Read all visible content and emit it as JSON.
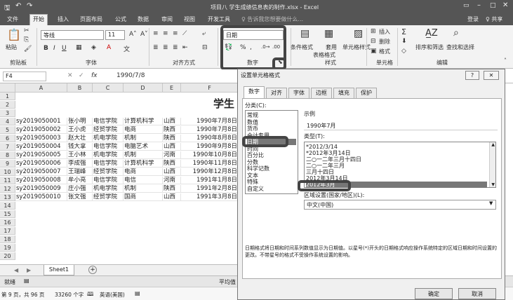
{
  "titlebar": {
    "title": "项目八 学生成绩信息表的制作.xlsx - Excel"
  },
  "ribbon_tabs": [
    "文件",
    "开始",
    "插入",
    "页面布局",
    "公式",
    "数据",
    "审阅",
    "视图",
    "开发工具"
  ],
  "tell_me": "♀ 告诉我您想要做什么...",
  "account": {
    "login": "登录",
    "share": "♀ 共享"
  },
  "ribbon": {
    "paste": "粘贴",
    "font_name": "等线",
    "font_size": "11",
    "number_format": "日期",
    "bold": "B",
    "italic": "I",
    "underline": "U",
    "percent": "%",
    "comma": ",",
    "cond_format": "条件格式",
    "table_format_1": "套用",
    "table_format_2": "表格格式",
    "cell_style": "单元格样式",
    "insert": "插入",
    "delete": "删除",
    "format": "格式",
    "sort_filter": "排序和筛选",
    "find_select": "查找和选择",
    "groups": {
      "clipboard": "剪贴板",
      "font": "字体",
      "align": "对齐方式",
      "number": "数字",
      "styles": "样式",
      "cells": "单元格",
      "edit": "编辑"
    }
  },
  "formula_bar": {
    "name_box": "F4",
    "fx": "fx",
    "value": "1990/7/8"
  },
  "sheet": {
    "columns": [
      "A",
      "B",
      "C",
      "D",
      "E",
      "F"
    ],
    "rows": [
      "1",
      "2",
      "3",
      "4",
      "5",
      "6",
      "7",
      "8",
      "9",
      "10",
      "11",
      "12",
      "13",
      "14",
      "15",
      "16",
      "17",
      "18",
      "19",
      "20"
    ],
    "title_partial": "学生",
    "data": [
      [
        "sy2019050001",
        "张小明",
        "电信学院",
        "计算机科学",
        "山西",
        "1990年7月8日"
      ],
      [
        "sy2019050002",
        "王小虎",
        "经贸学院",
        "电商",
        "陕西",
        "1990年7月8日"
      ],
      [
        "sy2019050003",
        "赵大壮",
        "机电学院",
        "机制",
        "陕西",
        "1990年8月8日"
      ],
      [
        "sy2019050004",
        "钱大拿",
        "电信学院",
        "电脑艺术",
        "山西",
        "1990年9月8日"
      ],
      [
        "sy2019050005",
        "王小林",
        "机电学院",
        "机制",
        "河南",
        "1990年10月8日"
      ],
      [
        "sy2019050006",
        "李成强",
        "电信学院",
        "计算机科学",
        "陕西",
        "1990年11月8日"
      ],
      [
        "sy2019050007",
        "王瑞峰",
        "经贸学院",
        "电商",
        "山西",
        "1990年12月8日"
      ],
      [
        "sy2019050008",
        "牟小亮",
        "电信学院",
        "电信",
        "河南",
        "1991年1月8日"
      ],
      [
        "sy2019050009",
        "庄小强",
        "机电学院",
        "机制",
        "陕西",
        "1991年2月8日"
      ],
      [
        "sy2019050010",
        "张文强",
        "经贸学院",
        "国商",
        "山西",
        "1991年3月8日"
      ]
    ],
    "tab": "Sheet1",
    "add_sheet": "+"
  },
  "status": {
    "ready": "就绪",
    "average_partial": "平均值"
  },
  "taskbar": {
    "page": "第 9 页，共 96 页",
    "words": "33260 个字",
    "lang": "英语(美国)"
  },
  "dialog": {
    "title": "设置单元格格式",
    "help": "?",
    "close": "✕",
    "tabs": [
      "数字",
      "对齐",
      "字体",
      "边框",
      "填充",
      "保护"
    ],
    "category_label": "分类(C):",
    "categories": [
      "常规",
      "数值",
      "货币",
      "会计专用",
      "日期",
      "时间",
      "百分比",
      "分数",
      "科学记数",
      "文本",
      "特殊",
      "自定义"
    ],
    "sample_label": "示例",
    "sample_value": "1990年7月",
    "type_label": "类型(T):",
    "types": [
      "*2012/3/14",
      "*2012年3月14日",
      "二○一二年三月十四日",
      "二○一二年三月",
      "三月十四日",
      "2012年3月14日",
      "2012年3月"
    ],
    "locale_label": "区域设置(国家/地区)(L):",
    "locale_value": "中文(中国)",
    "description": "日期格式将日期和时间系列数值显示为日期值。以星号(*)开头的日期格式响应操作系统特定的区域日期和时间设置的更改。不带星号的格式不受操作系统设置的影响。",
    "ok": "确定",
    "cancel": "取消"
  }
}
